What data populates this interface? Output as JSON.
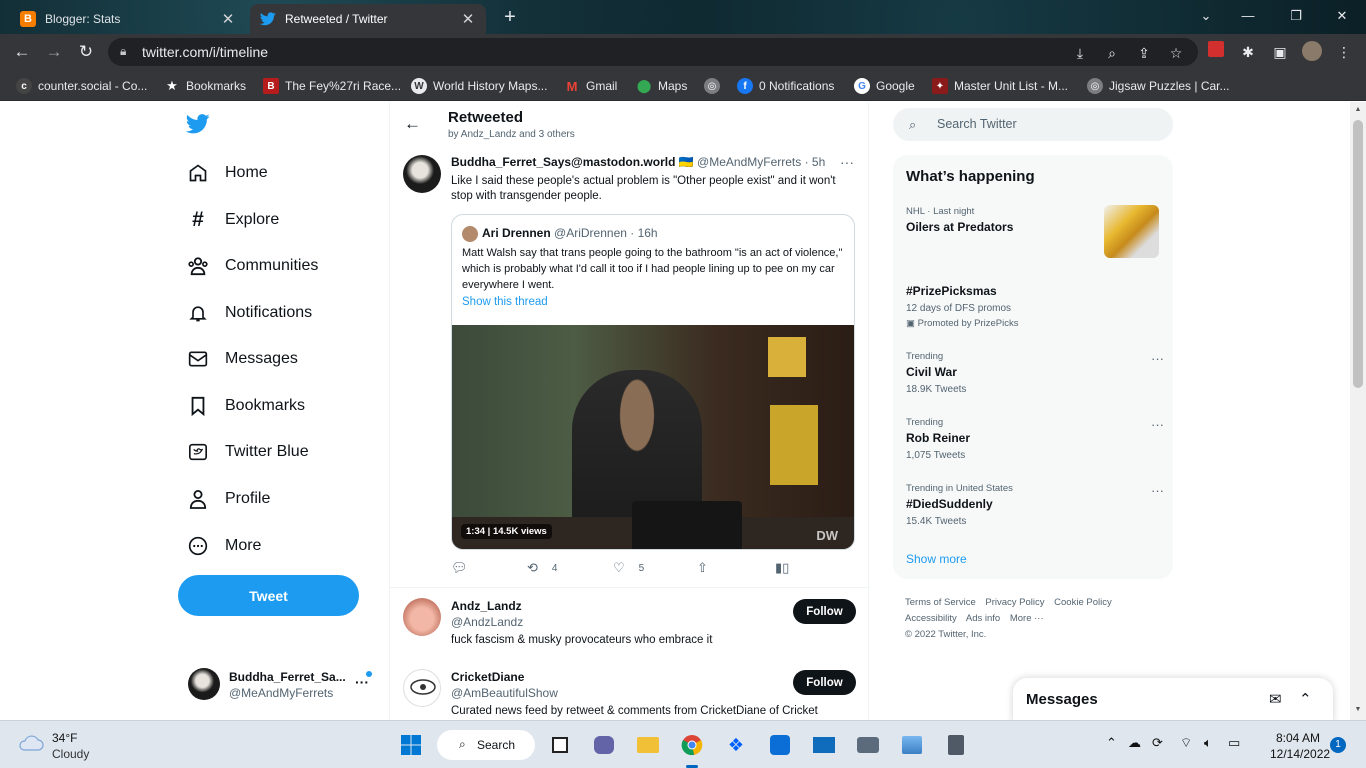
{
  "browser": {
    "tabs": [
      {
        "title": "Blogger: Stats",
        "favicon": "blogger-icon",
        "color": "#f57d00"
      },
      {
        "title": "Retweeted / Twitter",
        "favicon": "twitter-icon",
        "color": "#1d9bf0"
      }
    ],
    "url": "twitter.com/i/timeline",
    "bookmarks": [
      {
        "label": "counter.social - Co..."
      },
      {
        "label": "Bookmarks"
      },
      {
        "label": "The Fey%27ri Race..."
      },
      {
        "label": "World History Maps..."
      },
      {
        "label": "Gmail"
      },
      {
        "label": "Maps"
      },
      {
        "label": "0 Notifications"
      },
      {
        "label": "Google"
      },
      {
        "label": "Master Unit List - M..."
      },
      {
        "label": "Jigsaw Puzzles | Car..."
      }
    ]
  },
  "sidebar": {
    "items": [
      {
        "label": "Home"
      },
      {
        "label": "Explore"
      },
      {
        "label": "Communities"
      },
      {
        "label": "Notifications"
      },
      {
        "label": "Messages"
      },
      {
        "label": "Bookmarks"
      },
      {
        "label": "Twitter Blue"
      },
      {
        "label": "Profile"
      },
      {
        "label": "More"
      }
    ],
    "tweet_button": "Tweet",
    "account": {
      "name": "Buddha_Ferret_Sa...",
      "handle": "@MeAndMyFerrets"
    }
  },
  "main": {
    "title": "Retweeted",
    "subtitle": "by Andz_Landz and 3 others",
    "tweet": {
      "author": "Buddha_Ferret_Says@mastodon.world 🇺🇦",
      "handle": "@MeAndMyFerrets · 5h",
      "text": "Like I said these people's actual problem is \"Other people exist\" and it won't stop with transgender people.",
      "quote": {
        "author": "Ari Drennen",
        "handle": "@AriDrennen · 16h",
        "text": "Matt Walsh say that trans people going to the bathroom \"is an act of violence,\" which is probably what I'd call it too if I had people lining up to pee on my car everywhere I went.",
        "link": "Show this thread",
        "media_badge": "1:34 | 14.5K views",
        "media_watermark": "DW"
      },
      "retweets": "4",
      "likes": "5"
    },
    "users": [
      {
        "name": "Andz_Landz",
        "handle": "@AndzLandz",
        "bio": "fuck fascism & musky provocateurs who embrace it",
        "follow": "Follow"
      },
      {
        "name": "CricketDiane",
        "handle": "@AmBeautifulShow",
        "bio": "Curated news feed by retweet & comments from CricketDiane of Cricket",
        "follow": "Follow"
      }
    ]
  },
  "right": {
    "search_placeholder": "Search Twitter",
    "trends_title": "What’s happening",
    "trends": [
      {
        "category": "NHL · Last night",
        "name": "Oilers at Predators",
        "count": ""
      },
      {
        "category": "",
        "name": "#PrizePicksmas",
        "count": "12 days of DFS promos",
        "promo": "Promoted by PrizePicks"
      },
      {
        "category": "Trending",
        "name": "Civil War",
        "count": "18.9K Tweets"
      },
      {
        "category": "Trending",
        "name": "Rob Reiner",
        "count": "1,075 Tweets"
      },
      {
        "category": "Trending in United States",
        "name": "#DiedSuddenly",
        "count": "15.4K Tweets"
      }
    ],
    "show_more": "Show more",
    "footer": {
      "terms": "Terms of Service",
      "privacy": "Privacy Policy",
      "cookie": "Cookie Policy",
      "accessibility": "Accessibility",
      "ads": "Ads info",
      "more": "More ···",
      "copyright": "© 2022 Twitter, Inc."
    },
    "messages_title": "Messages"
  },
  "taskbar": {
    "temp": "34°F",
    "condition": "Cloudy",
    "search_label": "Search",
    "time": "8:04 AM",
    "date": "12/14/2022",
    "notification_count": "1"
  }
}
